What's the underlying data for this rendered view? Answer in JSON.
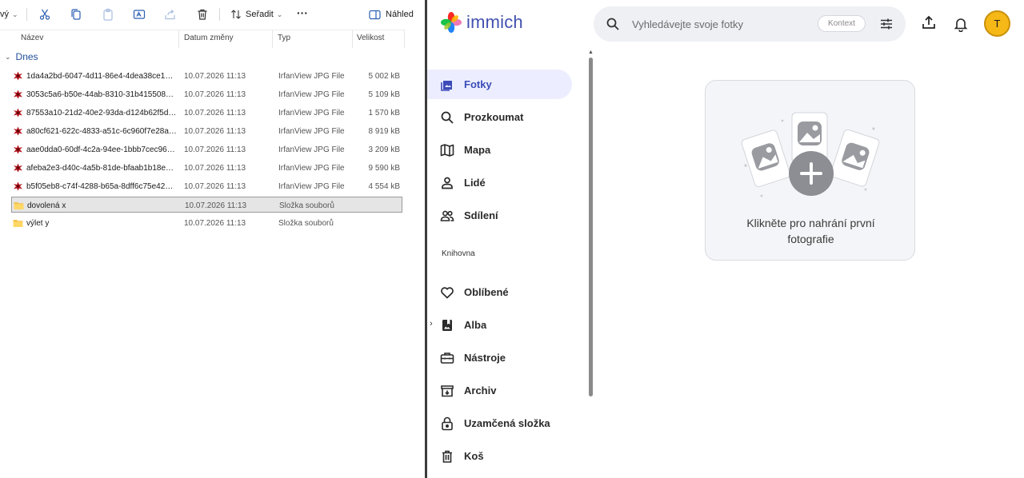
{
  "explorer": {
    "toolbar": {
      "new_label": "vý",
      "sort_label": "Seřadit",
      "more_label": "···",
      "preview_label": "Náhled"
    },
    "columns": {
      "name": "Název",
      "date": "Datum změny",
      "type": "Typ",
      "size": "Velikost"
    },
    "group_label": "Dnes",
    "files": [
      {
        "name": "1da4a2bd-6047-4d11-86e4-4dea38ce131...",
        "date": "10.07.2026 11:13",
        "type": "IrfanView JPG File",
        "size": "5 002 kB",
        "kind": "image"
      },
      {
        "name": "3053c5a6-b50e-44ab-8310-31b415508dc4...",
        "date": "10.07.2026 11:13",
        "type": "IrfanView JPG File",
        "size": "5 109 kB",
        "kind": "image"
      },
      {
        "name": "87553a10-21d2-40e2-93da-d124b62f5d19...",
        "date": "10.07.2026 11:13",
        "type": "IrfanView JPG File",
        "size": "1 570 kB",
        "kind": "image"
      },
      {
        "name": "a80cf621-622c-4833-a51c-6c960f7e28a6.j...",
        "date": "10.07.2026 11:13",
        "type": "IrfanView JPG File",
        "size": "8 919 kB",
        "kind": "image"
      },
      {
        "name": "aae0dda0-60df-4c2a-94ee-1bbb7cec9607...",
        "date": "10.07.2026 11:13",
        "type": "IrfanView JPG File",
        "size": "3 209 kB",
        "kind": "image"
      },
      {
        "name": "afeba2e3-d40c-4a5b-81de-bfaab1b18eb6...",
        "date": "10.07.2026 11:13",
        "type": "IrfanView JPG File",
        "size": "9 590 kB",
        "kind": "image"
      },
      {
        "name": "b5f05eb8-c74f-4288-b65a-8dff6c75e424.j...",
        "date": "10.07.2026 11:13",
        "type": "IrfanView JPG File",
        "size": "4 554 kB",
        "kind": "image"
      },
      {
        "name": "dovolená x",
        "date": "10.07.2026 11:13",
        "type": "Složka souborů",
        "size": "",
        "kind": "folder",
        "selected": true
      },
      {
        "name": "výlet y",
        "date": "10.07.2026 11:13",
        "type": "Složka souborů",
        "size": "",
        "kind": "folder"
      }
    ]
  },
  "immich": {
    "app_name": "immich",
    "search": {
      "placeholder": "Vyhledávejte svoje fotky",
      "context_chip": "Kontext"
    },
    "user_initial": "T",
    "nav": [
      {
        "label": "Fotky",
        "icon": "photos-icon",
        "active": true
      },
      {
        "label": "Prozkoumat",
        "icon": "search-icon"
      },
      {
        "label": "Mapa",
        "icon": "map-icon"
      },
      {
        "label": "Lidé",
        "icon": "person-icon"
      },
      {
        "label": "Sdílení",
        "icon": "people-icon"
      }
    ],
    "library_section": "Knihovna",
    "library": [
      {
        "label": "Oblíbené",
        "icon": "heart-icon"
      },
      {
        "label": "Alba",
        "icon": "album-icon",
        "expandable": true
      },
      {
        "label": "Nástroje",
        "icon": "toolbox-icon"
      },
      {
        "label": "Archiv",
        "icon": "archive-icon"
      },
      {
        "label": "Uzamčená složka",
        "icon": "lock-icon"
      },
      {
        "label": "Koš",
        "icon": "trash-icon"
      }
    ],
    "empty_state": "Klikněte pro nahrání první fotografie",
    "colors": {
      "accent": "#4250af",
      "active_bg": "#eceeff",
      "avatar": "#f5b817"
    }
  }
}
